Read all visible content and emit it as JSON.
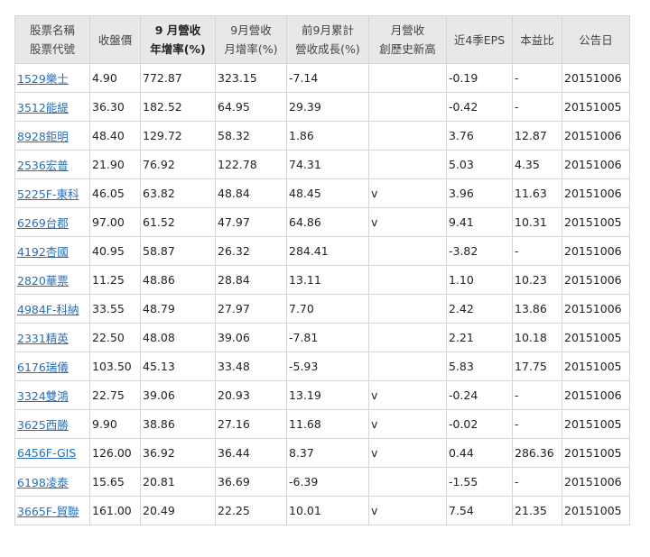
{
  "table": {
    "headers": [
      {
        "line1": "股票名稱",
        "line2": "股票代號"
      },
      {
        "line1": "收盤價",
        "line2": ""
      },
      {
        "line1": "9 月營收",
        "line2": "年增率(%)"
      },
      {
        "line1": "9月營收",
        "line2": "月增率(%)"
      },
      {
        "line1": "前9月累計",
        "line2": "營收成長(%)"
      },
      {
        "line1": "月營收",
        "line2": "創歷史新高"
      },
      {
        "line1": "近4季EPS",
        "line2": ""
      },
      {
        "line1": "本益比",
        "line2": ""
      },
      {
        "line1": "公告日",
        "line2": ""
      }
    ],
    "rows": [
      {
        "stock": "1529樂士",
        "close": "4.90",
        "yoy": "772.87",
        "mom": "323.15",
        "ytd": "-7.14",
        "record": "",
        "eps": "-0.19",
        "pe": "-",
        "date": "20151006"
      },
      {
        "stock": "3512能緹",
        "close": "36.30",
        "yoy": "182.52",
        "mom": "64.95",
        "ytd": "29.39",
        "record": "",
        "eps": "-0.42",
        "pe": "-",
        "date": "20151005"
      },
      {
        "stock": "8928鉅明",
        "close": "48.40",
        "yoy": "129.72",
        "mom": "58.32",
        "ytd": "1.86",
        "record": "",
        "eps": "3.76",
        "pe": "12.87",
        "date": "20151006"
      },
      {
        "stock": "2536宏普",
        "close": "21.90",
        "yoy": "76.92",
        "mom": "122.78",
        "ytd": "74.31",
        "record": "",
        "eps": "5.03",
        "pe": "4.35",
        "date": "20151006"
      },
      {
        "stock": "5225F-東科",
        "close": "46.05",
        "yoy": "63.82",
        "mom": "48.84",
        "ytd": "48.45",
        "record": "v",
        "eps": "3.96",
        "pe": "11.63",
        "date": "20151006"
      },
      {
        "stock": "6269台郡",
        "close": "97.00",
        "yoy": "61.52",
        "mom": "47.97",
        "ytd": "64.86",
        "record": "v",
        "eps": "9.41",
        "pe": "10.31",
        "date": "20151005"
      },
      {
        "stock": "4192杏國",
        "close": "40.95",
        "yoy": "58.87",
        "mom": "26.32",
        "ytd": "284.41",
        "record": "",
        "eps": "-3.82",
        "pe": "-",
        "date": "20151006"
      },
      {
        "stock": "2820華票",
        "close": "11.25",
        "yoy": "48.86",
        "mom": "28.84",
        "ytd": "13.11",
        "record": "",
        "eps": "1.10",
        "pe": "10.23",
        "date": "20151006"
      },
      {
        "stock": "4984F-科納",
        "close": "33.55",
        "yoy": "48.79",
        "mom": "27.97",
        "ytd": "7.70",
        "record": "",
        "eps": "2.42",
        "pe": "13.86",
        "date": "20151006"
      },
      {
        "stock": "2331精英",
        "close": "22.50",
        "yoy": "48.08",
        "mom": "39.06",
        "ytd": "-7.81",
        "record": "",
        "eps": "2.21",
        "pe": "10.18",
        "date": "20151005"
      },
      {
        "stock": "6176瑞儀",
        "close": "103.50",
        "yoy": "45.13",
        "mom": "33.48",
        "ytd": "-5.93",
        "record": "",
        "eps": "5.83",
        "pe": "17.75",
        "date": "20151005"
      },
      {
        "stock": "3324雙鴻",
        "close": "22.75",
        "yoy": "39.06",
        "mom": "20.93",
        "ytd": "13.19",
        "record": "v",
        "eps": "-0.24",
        "pe": "-",
        "date": "20151006"
      },
      {
        "stock": "3625西勝",
        "close": "9.90",
        "yoy": "38.86",
        "mom": "27.16",
        "ytd": "11.68",
        "record": "v",
        "eps": "-0.02",
        "pe": "-",
        "date": "20151005"
      },
      {
        "stock": "6456F-GIS",
        "close": "126.00",
        "yoy": "36.92",
        "mom": "36.44",
        "ytd": "8.37",
        "record": "v",
        "eps": "0.44",
        "pe": "286.36",
        "date": "20151005"
      },
      {
        "stock": "6198凌泰",
        "close": "15.65",
        "yoy": "20.81",
        "mom": "36.69",
        "ytd": "-6.39",
        "record": "",
        "eps": "-1.55",
        "pe": "-",
        "date": "20151006"
      },
      {
        "stock": "3665F-貿聯",
        "close": "161.00",
        "yoy": "20.49",
        "mom": "22.25",
        "ytd": "10.01",
        "record": "v",
        "eps": "7.54",
        "pe": "21.35",
        "date": "20151005"
      }
    ]
  }
}
